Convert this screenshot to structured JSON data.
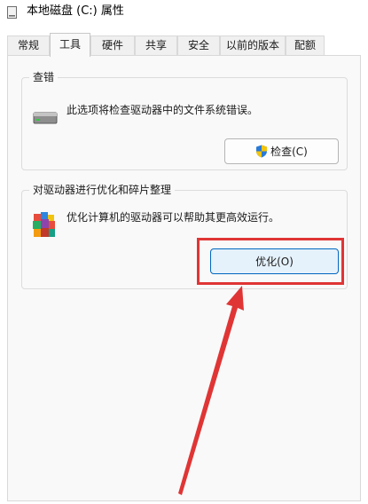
{
  "window": {
    "title": "本地磁盘 (C:) 属性",
    "title_icon": "drive-icon"
  },
  "tabs": [
    {
      "label": "常规",
      "active": false
    },
    {
      "label": "工具",
      "active": true
    },
    {
      "label": "硬件",
      "active": false
    },
    {
      "label": "共享",
      "active": false
    },
    {
      "label": "安全",
      "active": false
    },
    {
      "label": "以前的版本",
      "active": false
    },
    {
      "label": "配额",
      "active": false
    }
  ],
  "check_group": {
    "title": "查错",
    "description": "此选项将检查驱动器中的文件系统错误。",
    "icon": "hard-drive-icon",
    "button_label": "检查(C)",
    "button_icon": "uac-shield-icon"
  },
  "optimize_group": {
    "title": "对驱动器进行优化和碎片整理",
    "description": "优化计算机的驱动器可以帮助其更高效运行。",
    "icon": "defrag-icon",
    "button_label": "优化(O)"
  },
  "annotation": {
    "color": "#e03535",
    "highlight_target": "optimize-button",
    "arrow_icon": "red-arrow"
  },
  "colors": {
    "accent": "#0067c0",
    "panel_bg": "#f9f9f9"
  }
}
